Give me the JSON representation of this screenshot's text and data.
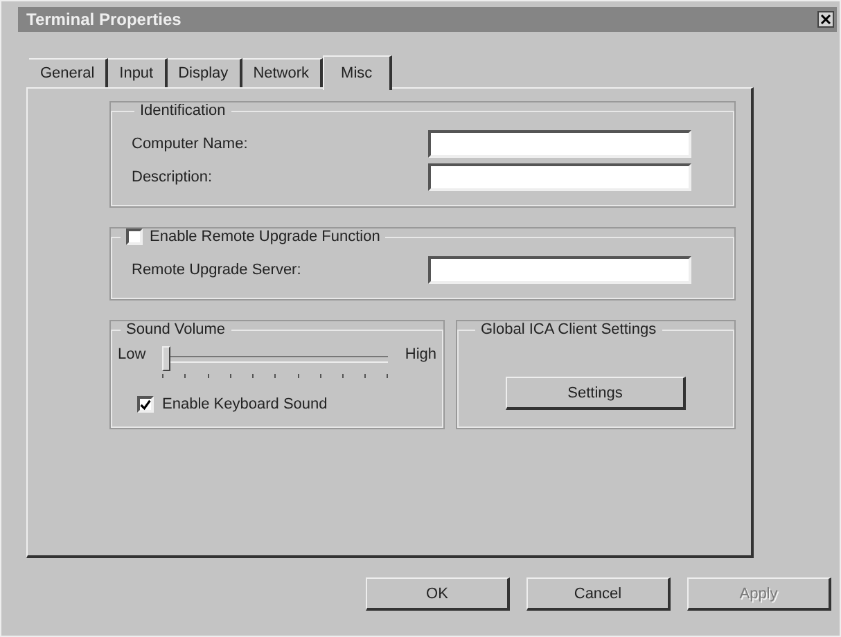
{
  "window": {
    "title": "Terminal Properties"
  },
  "tabs": [
    {
      "label": "General",
      "selected": false
    },
    {
      "label": "Input",
      "selected": false
    },
    {
      "label": "Display",
      "selected": false
    },
    {
      "label": "Network",
      "selected": false
    },
    {
      "label": "Misc",
      "selected": true
    }
  ],
  "identification": {
    "title": "Identification",
    "fields": [
      {
        "label": "Computer Name:"
      },
      {
        "label": "Description:"
      }
    ]
  },
  "remote_upgrade": {
    "label": "Enable Remote Upgrade Function",
    "checked": false,
    "field": {
      "label": "Remote Upgrade Server:"
    }
  },
  "sound_volume": {
    "title": "Sound Volume",
    "low": "Low",
    "high": "High",
    "level": 0,
    "keyboard_sound": {
      "label": "Enable Keyboard Sound",
      "checked": true
    }
  },
  "ica": {
    "title": "Global ICA Client Settings",
    "button": "Settings"
  },
  "buttons": [
    {
      "label": "OK",
      "disabled": false
    },
    {
      "label": "Cancel",
      "disabled": false
    },
    {
      "label": "Apply",
      "disabled": true
    }
  ]
}
